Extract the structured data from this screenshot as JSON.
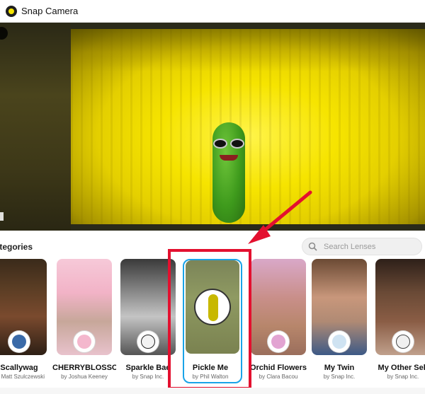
{
  "window": {
    "title": "Snap Camera"
  },
  "sidebar": {
    "categories_label": "Categories"
  },
  "search": {
    "placeholder": "Search Lenses"
  },
  "lenses": [
    {
      "name": "Scallywag",
      "author": "by Matt Szulczewski",
      "badge_icon": "pirate-avatar-icon"
    },
    {
      "name": "CHERRYBLOSSOM",
      "author": "by Joshua Keeney",
      "badge_icon": "flower-crown-icon"
    },
    {
      "name": "Sparkle Bae",
      "author": "by Snap Inc.",
      "badge_icon": "sparkle-faces-icon"
    },
    {
      "name": "Pickle Me",
      "author": "by Phil Walton",
      "badge_icon": "pickle-icon",
      "selected": true
    },
    {
      "name": "Orchid Flowers",
      "author": "by Clara Bacou",
      "badge_icon": "orchid-icon"
    },
    {
      "name": "My Twin",
      "author": "by Snap Inc.",
      "badge_icon": "twin-avatar-icon"
    },
    {
      "name": "My Other Self",
      "author": "by Snap Inc.",
      "badge_icon": "other-self-icon"
    }
  ],
  "colors": {
    "highlight": "#e3102f",
    "selection": "#1aa3e8",
    "pickle_bg": "#f6e400"
  }
}
